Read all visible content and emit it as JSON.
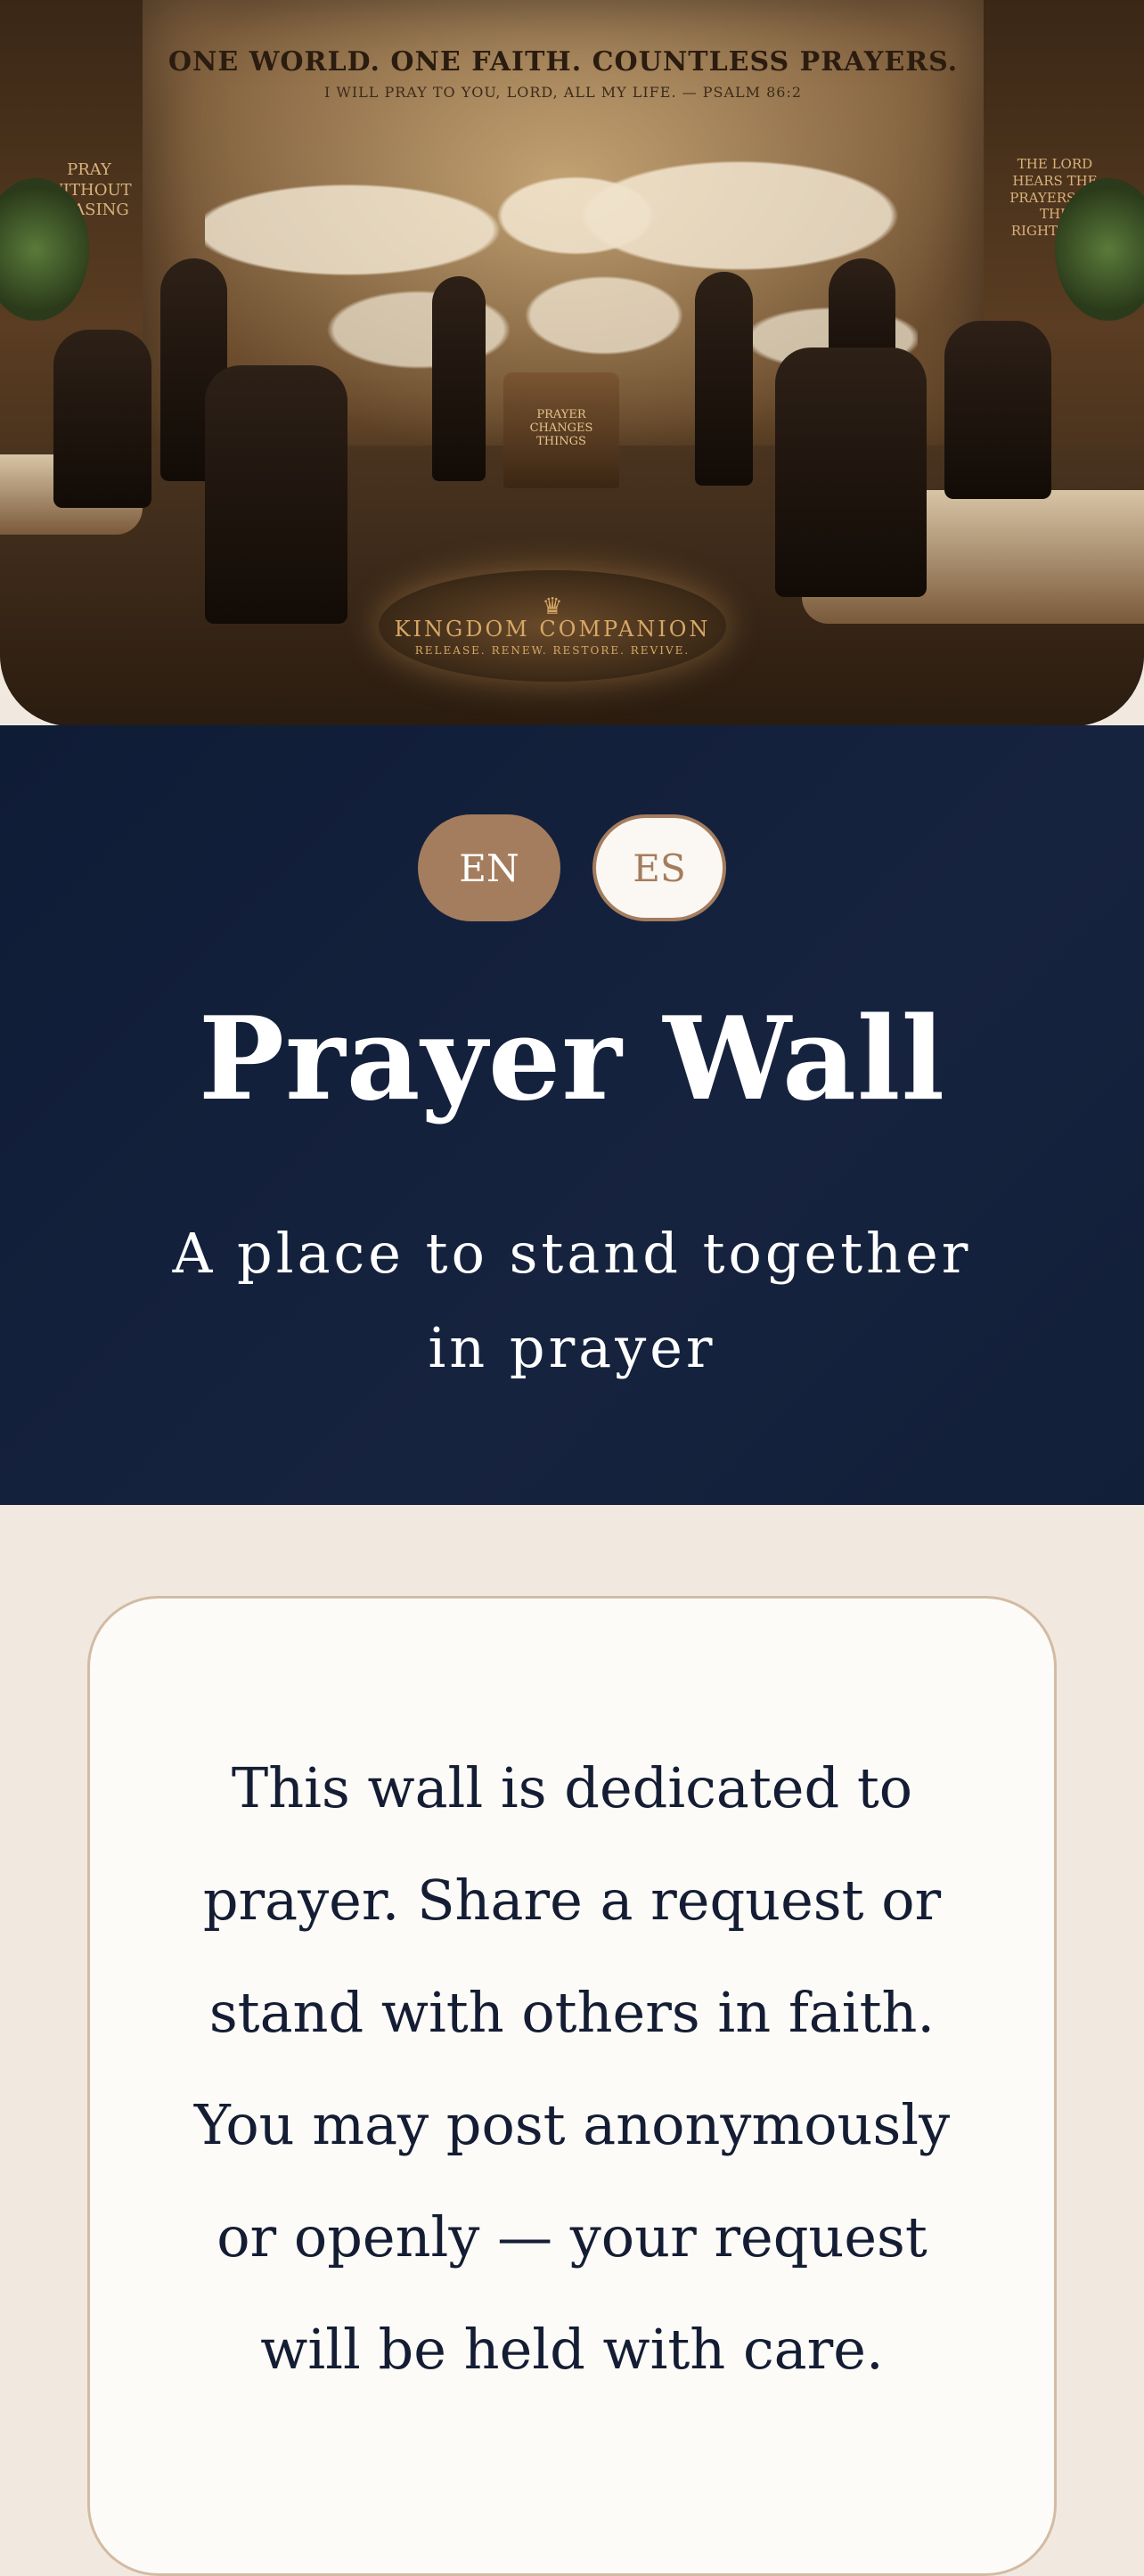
{
  "hero": {
    "wall_title": "ONE WORLD. ONE FAITH. COUNTLESS PRAYERS.",
    "wall_verse": "I WILL PRAY TO YOU, LORD, ALL MY LIFE. — PSALM 86:2",
    "left_panel": "PRAY WITHOUT CEASING",
    "right_panel": "THE LORD HEARS THE PRAYERS OF THE RIGHTEOUS",
    "pedestal": "PRAYER CHANGES THINGS",
    "emblem_brand": "KINGDOM COMPANION",
    "emblem_motto": "RELEASE. RENEW. RESTORE. REVIVE."
  },
  "language": {
    "options": [
      "EN",
      "ES"
    ],
    "selected": "EN"
  },
  "header": {
    "title": "Prayer Wall",
    "subtitle": "A place to stand together in prayer"
  },
  "intro": {
    "text": "This wall is dedicated to prayer. Share a request or stand with others in faith. You may post anonymously or openly — your request will be held with care."
  },
  "colors": {
    "navy": "#0f1c36",
    "accent": "#a47d5e",
    "cream": "#fcfbf8",
    "page_bg": "#f1e9e0"
  }
}
